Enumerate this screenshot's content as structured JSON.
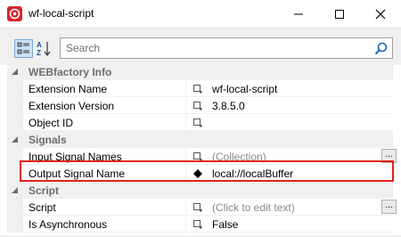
{
  "window": {
    "title": "wf-local-script",
    "accent": "#d9262c"
  },
  "toolbar": {
    "search_placeholder": "Search",
    "icons": [
      "categorized-icon",
      "alphabetical-icon",
      "search-icon"
    ]
  },
  "categories": [
    {
      "label": "WEBfactory Info",
      "properties": [
        {
          "name": "Extension Name",
          "value": "wf-local-script"
        },
        {
          "name": "Extension Version",
          "value": "3.8.5.0"
        },
        {
          "name": "Object ID",
          "value": ""
        }
      ]
    },
    {
      "label": "Signals",
      "properties": [
        {
          "name": "Input Signal Names",
          "value": "(Collection)"
        },
        {
          "name": "Output Signal Name",
          "value": "local://localBuffer"
        }
      ]
    },
    {
      "label": "Script",
      "properties": [
        {
          "name": "Script",
          "value": "(Click to edit text)"
        },
        {
          "name": "Is Asynchronous",
          "value": "False"
        }
      ]
    }
  ],
  "ellipsis_label": "...",
  "highlight_color": "#e2231a"
}
